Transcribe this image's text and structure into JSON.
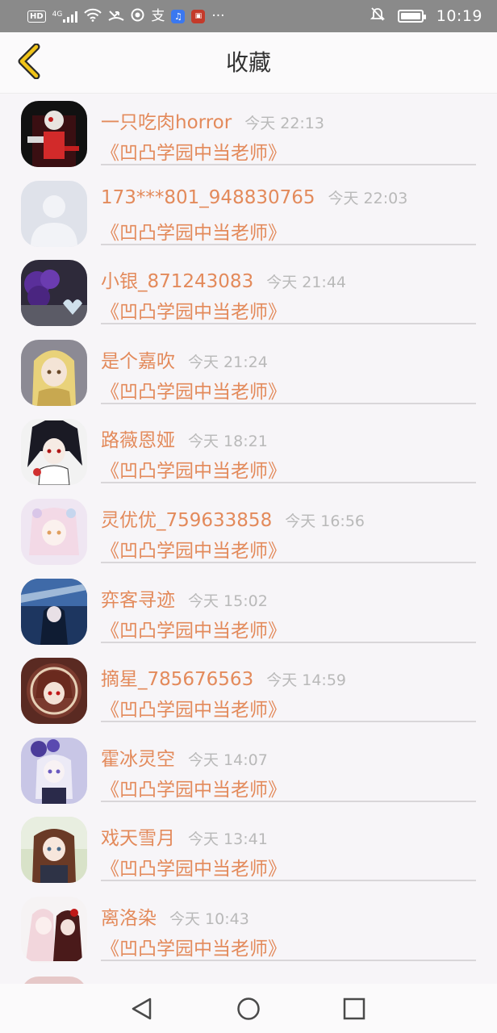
{
  "status_bar": {
    "hd": "HD",
    "network": "4G",
    "time": "10:19",
    "battery_level": 1.0,
    "icons": [
      "hd-icon",
      "signal-icon",
      "wifi-icon",
      "missed-call-icon",
      "app-icon",
      "pay-icon",
      "music-app-icon",
      "game-app-icon",
      "more-notifications-icon",
      "mute-icon",
      "battery-icon"
    ]
  },
  "header": {
    "title": "收藏",
    "back_icon": "chevron-left-icon",
    "accent_color": "#f0c419"
  },
  "colors": {
    "name": "#e38a5b",
    "time": "#b9b9b9",
    "divider": "#d9d6d9"
  },
  "items": [
    {
      "name": "一只吃肉horror",
      "time": "今天 22:13",
      "book": "《凹凸学园中当老师》"
    },
    {
      "name": "173***801_948830765",
      "time": "今天 22:03",
      "book": "《凹凸学园中当老师》"
    },
    {
      "name": "小银_871243083",
      "time": "今天 21:44",
      "book": "《凹凸学园中当老师》"
    },
    {
      "name": "是个嘉吹",
      "time": "今天 21:24",
      "book": "《凹凸学园中当老师》"
    },
    {
      "name": "路薇恩娅",
      "time": "今天 18:21",
      "book": "《凹凸学园中当老师》"
    },
    {
      "name": "灵优优_759633858",
      "time": "今天 16:56",
      "book": "《凹凸学园中当老师》"
    },
    {
      "name": "弈客寻迹",
      "time": "今天 15:02",
      "book": "《凹凸学园中当老师》"
    },
    {
      "name": "摘星_785676563",
      "time": "今天 14:59",
      "book": "《凹凸学园中当老师》"
    },
    {
      "name": "霍冰灵空",
      "time": "今天 14:07",
      "book": "《凹凸学园中当老师》"
    },
    {
      "name": "戏天雪月",
      "time": "今天 13:41",
      "book": "《凹凸学园中当老师》"
    },
    {
      "name": "离洛染",
      "time": "今天 10:43",
      "book": "《凹凸学园中当老师》"
    }
  ],
  "nav_bar": {
    "icons": [
      "nav-back-icon",
      "nav-home-icon",
      "nav-recent-icon"
    ]
  }
}
